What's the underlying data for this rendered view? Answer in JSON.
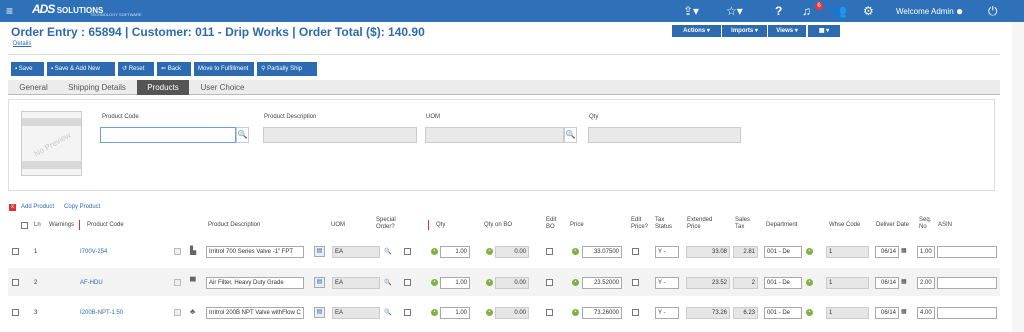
{
  "topbar": {
    "menu_icon": "menu-icon",
    "logo_main": "ADS",
    "logo_sub": "SOLUTIONS",
    "logo_tag": "TECHNOLOGY SOFTWARE",
    "share_icon": "share-icon",
    "star_icon": "star-icon",
    "help_icon": "help-icon",
    "bell_icon": "bell-icon",
    "notification_count": "6",
    "users_icon": "users-icon",
    "gear_icon": "gear-icon",
    "welcome": "Welcome Admin",
    "user_icon": "user-circle-icon",
    "power_icon": "power-icon"
  },
  "header": {
    "title": "Order Entry : 65894 | Customer: 011 - Drip Works | Order Total ($): 140.90",
    "details_link": "Details",
    "right_buttons": [
      "Actions ▾",
      "Imports ▾",
      "Views ▾",
      "▦ ▾"
    ]
  },
  "toolbar": {
    "save": "Save",
    "save_add_new": "Save & Add New",
    "reset": "Reset",
    "back": "Back",
    "move_to_fulfillment": "Move to Fulfillment",
    "partially_ship": "Partially Ship"
  },
  "tabs": [
    "General",
    "Shipping Details",
    "Products",
    "User Choice"
  ],
  "product_form": {
    "no_preview": "No Preview",
    "product_code_label": "Product Code",
    "product_description_label": "Product Description",
    "uom_label": "UOM",
    "qty_label": "Qty"
  },
  "links": {
    "add_product": "Add Product",
    "copy_product": "Copy Product"
  },
  "table": {
    "headers": {
      "ln": "Ln",
      "warnings": "Warnings",
      "product_code": "Product Code",
      "product_description": "Product Description",
      "uom": "UOM",
      "special_order": "Special Order?",
      "qty": "Qty",
      "qty_on_bo": "Qty on BO",
      "edit_bo": "Edit BO",
      "price": "Price",
      "edit_price": "Edit Price?",
      "tax_status": "Tax Status",
      "extended_price": "Extended Price",
      "sales_tax": "Sales Tax",
      "department": "Department",
      "whse_code": "Whse Code",
      "deliver_date": "Deliver Date",
      "seq_no": "Seq. No",
      "asin": "ASIN"
    },
    "rows": [
      {
        "ln": "1",
        "code": "I700V-254",
        "desc": "Irritrol 700 Series Valve -1\" FPT",
        "uom": "EA",
        "qty": "1.00",
        "qty_bo": "0.00",
        "price": "33.07500",
        "tax": "Y -",
        "ext": "33.08",
        "sales_tax": "2.81",
        "dept": "001 - De",
        "whse": "1",
        "date": "06/14",
        "seq": "1.00"
      },
      {
        "ln": "2",
        "code": "AF-HDU",
        "desc": "Air Filter, Heavy Duty Grade",
        "uom": "EA",
        "qty": "1.00",
        "qty_bo": "0.00",
        "price": "23.52000",
        "tax": "Y -",
        "ext": "23.52",
        "sales_tax": "2",
        "dept": "001 - De",
        "whse": "1",
        "date": "06/14",
        "seq": "2.00"
      },
      {
        "ln": "3",
        "code": "I200B-NPT-1.50",
        "desc": "Irritrol 200B NPT Valve withFlow C",
        "uom": "EA",
        "qty": "1.00",
        "qty_bo": "0.00",
        "price": "73.26000",
        "tax": "Y -",
        "ext": "73.26",
        "sales_tax": "6.23",
        "dept": "001 - De",
        "whse": "1",
        "date": "06/14",
        "seq": "4.00"
      }
    ]
  }
}
